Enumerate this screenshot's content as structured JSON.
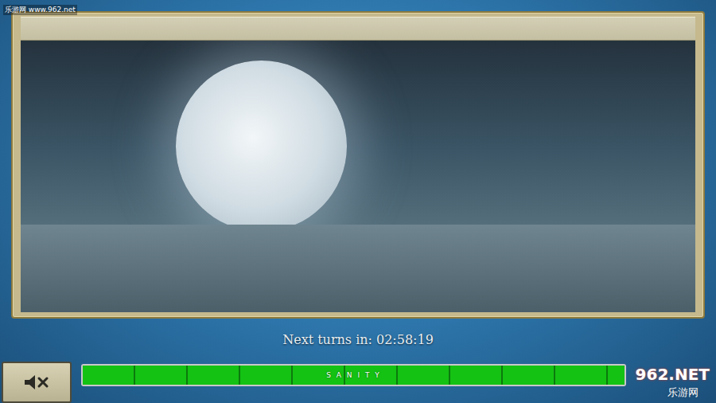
{
  "panel": {
    "title": ""
  },
  "status": {
    "label": "Next turns in:",
    "time": "02:58:19"
  },
  "sound_button": {
    "muted": true
  },
  "sanity_bar": {
    "label": "S A N I T Y",
    "level": 1.0
  },
  "watermarks": [
    {
      "text": "乐游网 www.962.net",
      "corner": "top-left"
    },
    {
      "text": "962.NET",
      "corner": "bottom-right"
    },
    {
      "text": "乐游网",
      "corner": "bottom-right-sub"
    }
  ]
}
